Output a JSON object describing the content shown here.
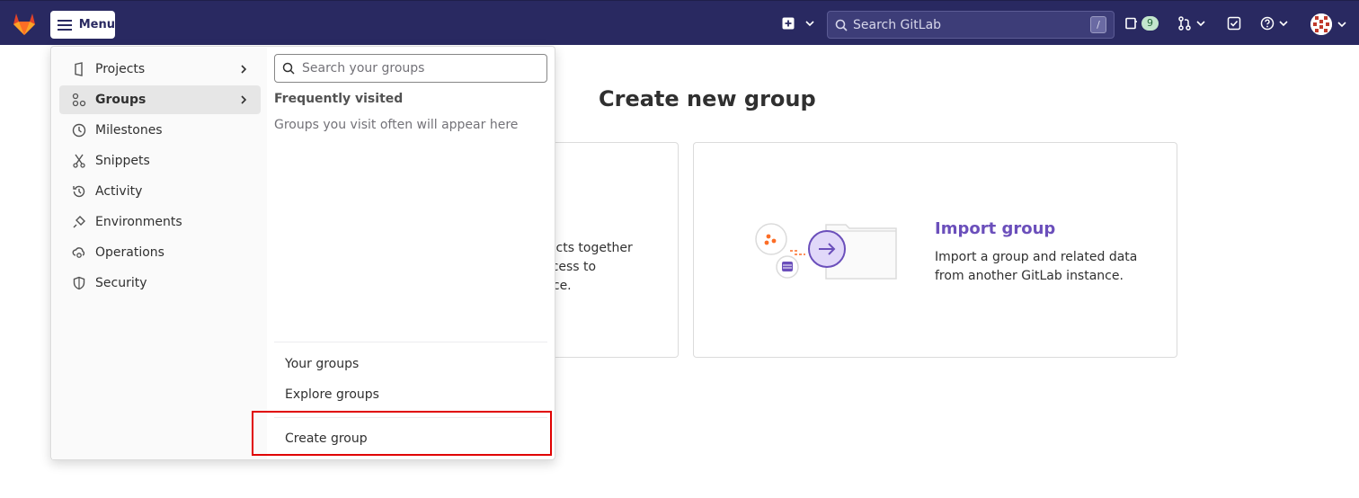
{
  "topbar": {
    "menu_label": "Menu",
    "search_placeholder": "Search GitLab",
    "search_shortcut": "/",
    "issues_count": "9"
  },
  "page": {
    "title": "Create new group",
    "left_card_fragments": [
      "jects together",
      "ccess to",
      "nce."
    ],
    "import_card": {
      "title": "Import group",
      "description": "Import a group and related data from another GitLab instance."
    }
  },
  "dropdown": {
    "nav_items": [
      {
        "label": "Projects",
        "icon": "project-icon",
        "has_chevron": true
      },
      {
        "label": "Groups",
        "icon": "group-icon",
        "has_chevron": true,
        "active": true
      },
      {
        "label": "Milestones",
        "icon": "clock-icon"
      },
      {
        "label": "Snippets",
        "icon": "snippet-icon"
      },
      {
        "label": "Activity",
        "icon": "history-icon"
      },
      {
        "label": "Environments",
        "icon": "environment-icon"
      },
      {
        "label": "Operations",
        "icon": "cloud-gear-icon"
      },
      {
        "label": "Security",
        "icon": "shield-icon"
      }
    ],
    "groups_panel": {
      "search_placeholder": "Search your groups",
      "frequent_title": "Frequently visited",
      "frequent_empty": "Groups you visit often will appear here",
      "links": [
        "Your groups",
        "Explore groups",
        "Create group"
      ]
    }
  },
  "colors": {
    "topbar": "#292961",
    "accent": "#6b4fbb",
    "highlight": "#e00000"
  }
}
